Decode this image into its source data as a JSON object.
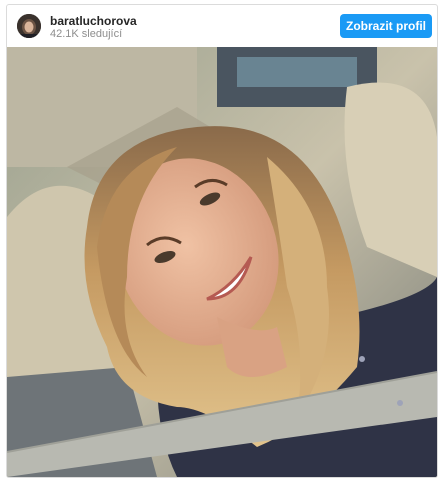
{
  "header": {
    "username": "baratluchorova",
    "followers": "42.1K sledující",
    "view_profile_label": "Zobrazit profil"
  },
  "post": {
    "avatar": "profile-avatar",
    "photo": "selfie-photo"
  },
  "colors": {
    "button": "#1a9af5",
    "border": "#dbdbdb",
    "username": "#262626",
    "muted": "#8e8e8e"
  }
}
